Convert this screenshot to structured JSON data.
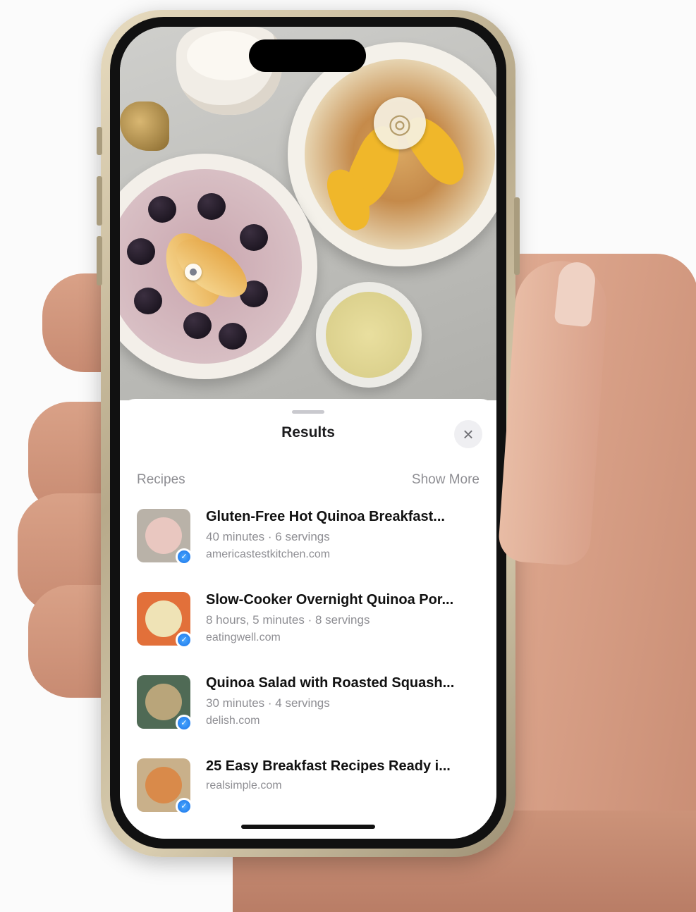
{
  "sheet": {
    "title": "Results",
    "close_icon": "×",
    "section_title": "Recipes",
    "show_more": "Show More"
  },
  "results": [
    {
      "title": "Gluten-Free Hot Quinoa Breakfast...",
      "meta": "40 minutes · 6 servings",
      "source": "americastestkitchen.com",
      "thumb_bg": "#b9b2a8",
      "plate_color": "#e9c7c0",
      "icon": "safari-icon"
    },
    {
      "title": "Slow-Cooker Overnight Quinoa Por...",
      "meta": "8 hours, 5 minutes · 8 servings",
      "source": "eatingwell.com",
      "thumb_bg": "#e2703a",
      "plate_color": "#efe3b6",
      "icon": "safari-icon"
    },
    {
      "title": "Quinoa Salad with Roasted Squash...",
      "meta": "30 minutes · 4 servings",
      "source": "delish.com",
      "thumb_bg": "#4f6a55",
      "plate_color": "#b9a57a",
      "icon": "safari-icon"
    },
    {
      "title": "25 Easy Breakfast Recipes Ready i...",
      "meta": "",
      "source": "realsimple.com",
      "thumb_bg": "#c9b08a",
      "plate_color": "#d98a4a",
      "icon": "safari-icon"
    }
  ],
  "colors": {
    "sheet_bg": "#ffffff",
    "accent_blue": "#1a73e8",
    "secondary_text": "#8e8e93"
  }
}
